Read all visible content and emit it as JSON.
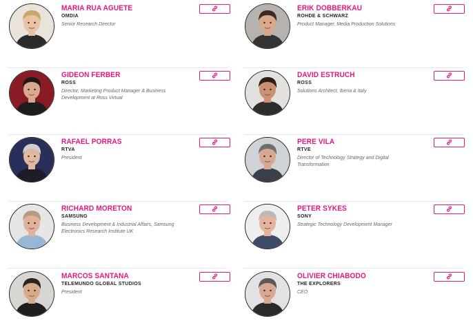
{
  "accent_color": "#e5177f",
  "speakers": [
    {
      "name": "MARIA RUA AGUETE",
      "company": "OMDIA",
      "role": "Senior Research Director",
      "link_icon": "link-icon",
      "avatar_bg": "#e9e3dc",
      "hair": "#c9a66b",
      "skin": "#e8c3a6",
      "shirt": "#2b2b2b"
    },
    {
      "name": "ERIK DOBBERKAU",
      "company": "ROHDE & SCHWARZ",
      "role": "Product Manager, Media Production Solutions",
      "link_icon": "link-icon",
      "avatar_bg": "#b7b2ad",
      "hair": "#3b2a20",
      "skin": "#d7a88a",
      "shirt": "#333333"
    },
    {
      "name": "GIDEON FERBER",
      "company": "ROSS",
      "role": "Director, Marketing Product Manager & Business Development at Ross Virtual",
      "link_icon": "link-icon",
      "avatar_bg": "#8a1a24",
      "hair": "#1f1a17",
      "skin": "#d9a88e",
      "shirt": "#1d1d1d"
    },
    {
      "name": "DAVID ESTRUCH",
      "company": "ROSS",
      "role": "Solutions Architect, Iberia & Italy",
      "link_icon": "link-icon",
      "avatar_bg": "#e3e1de",
      "hair": "#2a1e16",
      "skin": "#c99072",
      "shirt": "#2d2d2d"
    },
    {
      "name": "RAFAEL PORRAS",
      "company": "RTVA",
      "role": "President",
      "link_icon": "link-icon",
      "avatar_bg": "#2a2f5a",
      "hair": "#cfcfcf",
      "skin": "#e0b9a0",
      "shirt": "#1c1c2a"
    },
    {
      "name": "PERE VILA",
      "company": "RTVE",
      "role": "Director of Technology Strategy and Digital Transformation",
      "link_icon": "link-icon",
      "avatar_bg": "#cfd2d6",
      "hair": "#6e6e6e",
      "skin": "#d8a892",
      "shirt": "#3a3f4a"
    },
    {
      "name": "RICHARD MORETON",
      "company": "SAMSUNG",
      "role": "Business Development & Industrial Affairs, Samsung Electronics Research Institute UK",
      "link_icon": "link-icon",
      "avatar_bg": "#e6e6e6",
      "hair": "#b89a84",
      "skin": "#e0b29a",
      "shirt": "#9ab6d6"
    },
    {
      "name": "PETER SYKES",
      "company": "SONY",
      "role": "Strategic Technology Development Manager",
      "link_icon": "link-icon",
      "avatar_bg": "#eeeeee",
      "hair": "#b9b9b9",
      "skin": "#e4b39b",
      "shirt": "#3d4b66"
    },
    {
      "name": "MARCOS SANTANA",
      "company": "TELEMUNDO GLOBAL STUDIOS",
      "role": "President",
      "link_icon": "link-icon",
      "avatar_bg": "#d8d6d3",
      "hair": "#2a2420",
      "skin": "#d9a98c",
      "shirt": "#1e1e1e"
    },
    {
      "name": "OLIVIER CHIABODO",
      "company": "THE EXPLORERS",
      "role": "CEO",
      "link_icon": "link-icon",
      "avatar_bg": "#e2e2e2",
      "hair": "#5a5a5a",
      "skin": "#d9a893",
      "shirt": "#2a2a2a"
    }
  ]
}
